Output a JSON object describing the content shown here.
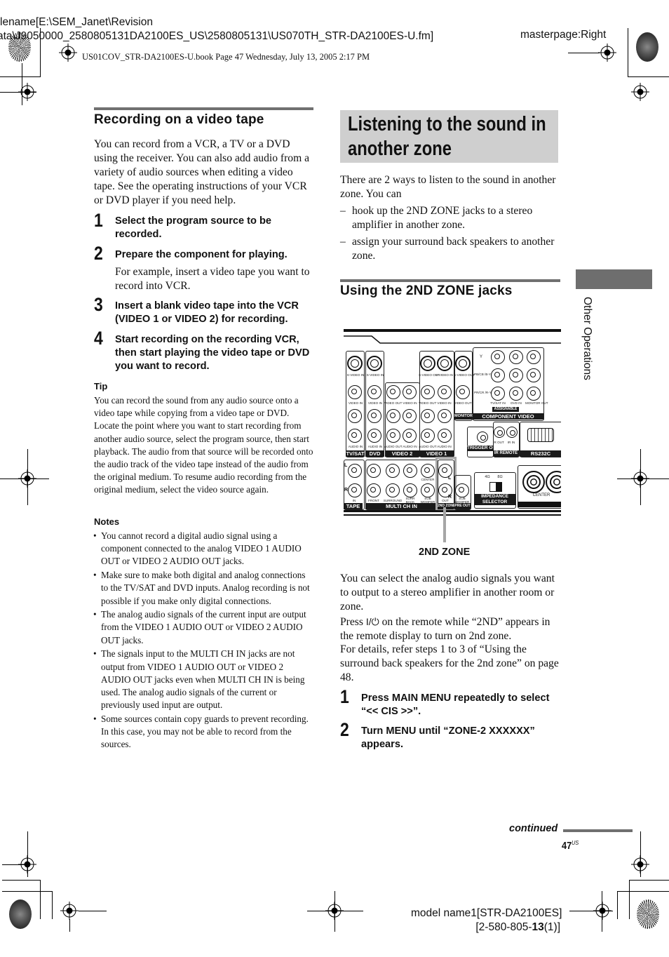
{
  "print_header": {
    "filename_line1": "lename[E:\\SEM_Janet\\Revision",
    "filename_line2": "ata\\J9050000_2580805131DA2100ES_US\\2580805131\\US070TH_STR-DA2100ES-U.fm]",
    "masterpage": "masterpage:Right",
    "book_line": "US01COV_STR-DA2100ES-U.book  Page 47  Wednesday, July 13, 2005  2:17 PM"
  },
  "left": {
    "heading": "Recording on a video tape",
    "intro": "You can record from a VCR, a TV or a DVD using the receiver. You can also add audio from a variety of audio sources when editing a video tape. See the operating instructions of your VCR or DVD player if you need help.",
    "steps": [
      {
        "num": "1",
        "text": "Select the program source to be recorded.",
        "detail": ""
      },
      {
        "num": "2",
        "text": "Prepare the component for playing.",
        "detail": "For example, insert a video tape you want to record into VCR."
      },
      {
        "num": "3",
        "text": "Insert a blank video tape into the VCR (VIDEO 1 or VIDEO 2) for recording.",
        "detail": ""
      },
      {
        "num": "4",
        "text": "Start recording on the recording VCR, then start playing the video tape or DVD you want to record.",
        "detail": ""
      }
    ],
    "tip_heading": "Tip",
    "tip_text": "You can record the sound from any audio source onto a video tape while copying from a video tape or DVD. Locate the point where you want to start recording from another audio source, select the program source, then start playback. The audio from that source will be recorded onto the audio track of the video tape instead of the audio from the original medium. To resume audio recording from the original medium, select the video source again.",
    "notes_heading": "Notes",
    "notes": [
      "You cannot record a digital audio signal using a component connected to the analog VIDEO 1 AUDIO OUT or VIDEO 2 AUDIO OUT jacks.",
      "Make sure to make both digital and analog connections to the TV/SAT and DVD inputs. Analog recording is not possible if you make only digital connections.",
      "The analog audio signals of the current input are output from the VIDEO 1 AUDIO OUT or VIDEO 2 AUDIO OUT jacks.",
      "The signals input to the MULTI CH IN jacks are not output from VIDEO 1 AUDIO OUT or VIDEO 2 AUDIO OUT jacks even when MULTI CH IN is being used. The analog audio signals of the current or previously used input are output.",
      "Some sources contain copy guards to prevent recording. In this case, you may not be able to record from the sources."
    ]
  },
  "right": {
    "title_line1": "Listening to the sound in",
    "title_line2": "another zone",
    "intro": "There are 2 ways to listen to the sound in another zone. You can",
    "options": [
      "hook up the 2ND ZONE jacks to a stereo amplifier in another zone.",
      "assign your surround back speakers to another zone."
    ],
    "subheading": "Using the 2ND ZONE jacks",
    "diagram": {
      "callout": "2ND ZONE",
      "groups": [
        "TV/SAT",
        "DVD",
        "VIDEO 2",
        "VIDEO 1",
        "MONITOR",
        "COMPONENT VIDEO",
        "ASSIGNABLE",
        "TRIGGER OUT",
        "IR REMOTE",
        "RS232C",
        "TAPE",
        "MULTI CH IN",
        "2ND ZONE",
        "PRE OUT",
        "IMPEDANCE SELECTOR"
      ],
      "jack_labels": {
        "svideo_in": "S-VIDEO IN",
        "svideo_out": "S-VIDEO OUT",
        "video_in": "VIDEO IN",
        "video_out": "VIDEO OUT",
        "audio_in": "AUDIO IN",
        "audio_out": "AUDIO OUT",
        "y": "Y",
        "pb": "PB/CB /B-Y",
        "pr": "PR/CR /R-Y",
        "tvsat_in": "TV/SAT IN",
        "dvd_in": "DVD IN",
        "monitor_out": "MONITOR OUT",
        "ir_out": "IR OUT",
        "ir_in": "IR IN",
        "in": "IN",
        "front": "FRONT",
        "surround": "SURROUND",
        "surr_back": "SURR BACK",
        "center": "CENTER",
        "sub_woofer": "SUB WOOFER",
        "out": "OUT",
        "ohm4": "4Ω",
        "ohm8": "8Ω",
        "center_speaker": "CENTER",
        "L": "L",
        "R": "R"
      }
    },
    "para1": "You can select the analog audio signals you want to output to a stereo amplifier in another room or zone.",
    "para2_pre": "Press ",
    "para2_symbol": "I/⏻",
    "para2_post": " on the remote while “2ND” appears in the remote display to turn on 2nd zone.",
    "para3": "For details, refer steps 1 to 3 of “Using the surround back speakers for the 2nd zone” on page 48.",
    "steps": [
      {
        "num": "1",
        "text": "Press MAIN MENU repeatedly to select “<<  CIS  >>”."
      },
      {
        "num": "2",
        "text": "Turn MENU until “ZONE-2 XXXXXX” appears."
      }
    ]
  },
  "side_tab": "Other Operations",
  "footer": {
    "continued": "continued",
    "page_number": "47",
    "page_suffix": "US",
    "model_line1": "model name1[STR-DA2100ES]",
    "model_line2_pre": "[2-580-805-",
    "model_line2_bold": "13",
    "model_line2_post": "(1)]"
  }
}
